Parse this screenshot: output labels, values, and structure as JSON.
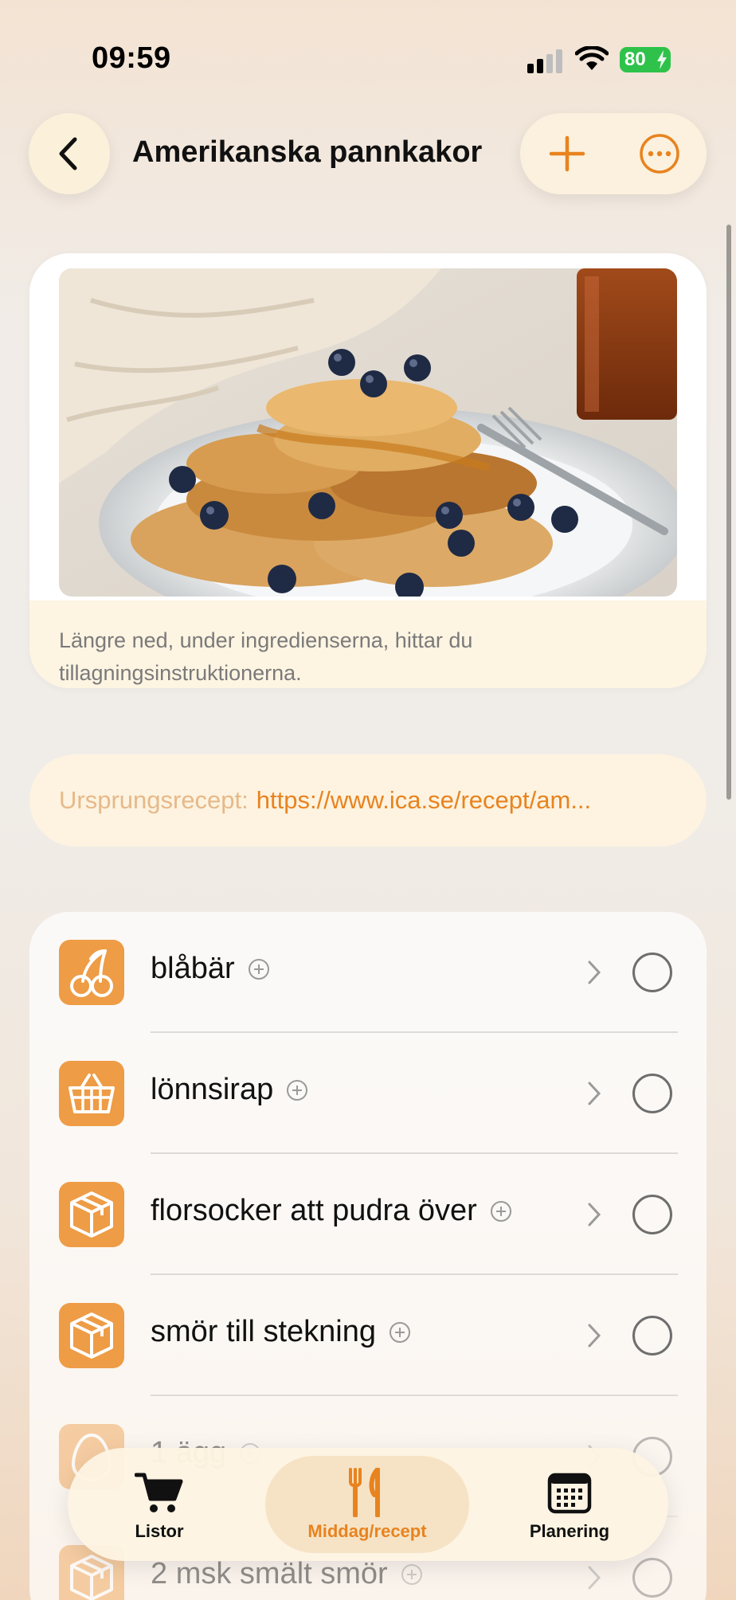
{
  "status": {
    "time": "09:59",
    "battery": "80"
  },
  "nav": {
    "title": "Amerikanska pannkakor"
  },
  "hero": {
    "caption": "Längre ned, under ingredienserna, hittar du tillagningsinstruktionerna."
  },
  "source": {
    "label": "Ursprungsrecept:",
    "link": "https://www.ica.se/recept/am..."
  },
  "ingredients": [
    {
      "label": "blåbär",
      "icon": "cherry-icon"
    },
    {
      "label": "lönnsirap",
      "icon": "basket-icon"
    },
    {
      "label": "florsocker att pudra över",
      "icon": "box-icon"
    },
    {
      "label": "smör till stekning",
      "icon": "box-icon"
    },
    {
      "label": "1 ägg",
      "icon": "egg-icon"
    },
    {
      "label": "2 msk smält smör",
      "icon": "box-icon"
    }
  ],
  "tabs": [
    {
      "label": "Listor",
      "icon": "cart-icon"
    },
    {
      "label": "Middag/recept",
      "icon": "cutlery-icon"
    },
    {
      "label": "Planering",
      "icon": "calendar-icon"
    }
  ],
  "colors": {
    "accent": "#e8831f",
    "category_icon": "#ee9c45",
    "battery": "#2fc24a"
  }
}
